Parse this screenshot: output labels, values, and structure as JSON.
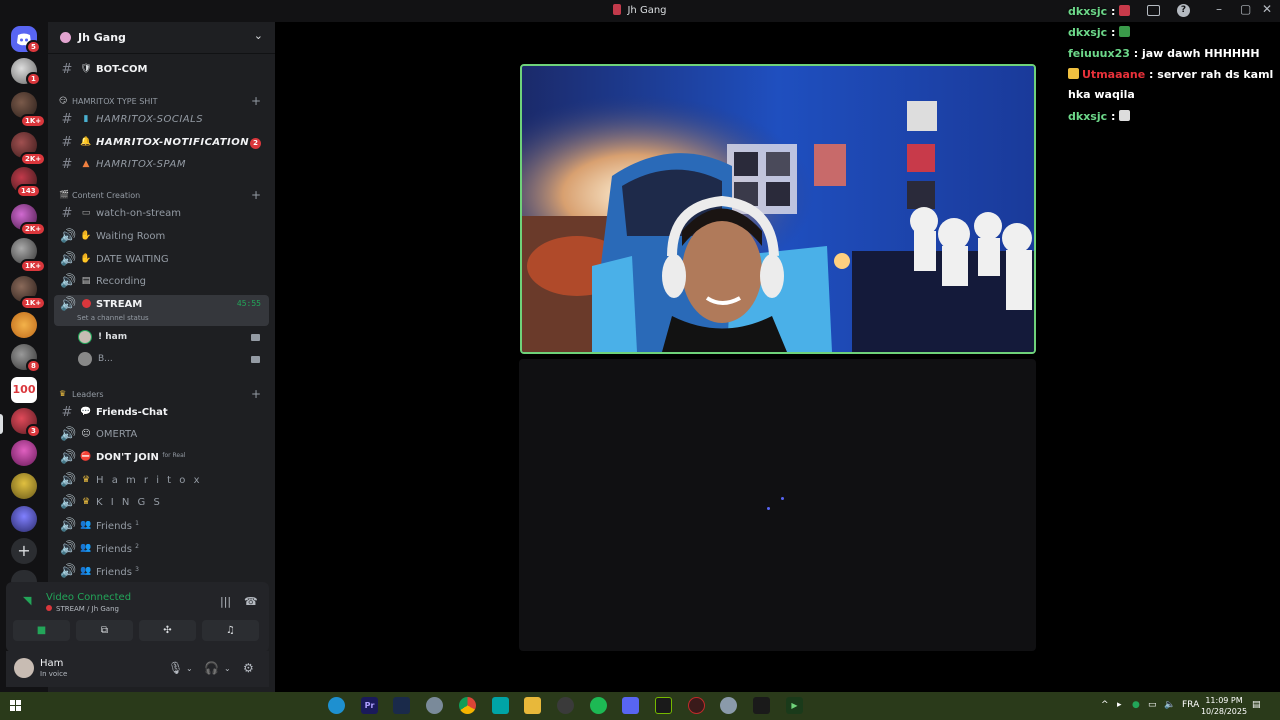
{
  "window": {
    "title": "Jh Gang"
  },
  "guild": {
    "name": "Jh Gang"
  },
  "rail_badges": [
    "5",
    "1",
    "1K+",
    "2K+",
    "143",
    "2K+",
    "1K+",
    "1K+",
    "8",
    "3"
  ],
  "channels": {
    "bot_com": {
      "emoji": "🛡",
      "name": "BOT-COM"
    },
    "cat_hamritox": {
      "emoji": "😏",
      "name": "HAMRITOX TYPE SHIT"
    },
    "socials": {
      "name": "HAMRITOX-SOCIALS"
    },
    "notification": {
      "name": "HAMRITOX-NOTIFICATION",
      "badge": "2"
    },
    "spam": {
      "name": "HAMRITOX-SPAM"
    },
    "cat_content": {
      "name": "Content Creation"
    },
    "watch_on_stream": {
      "name": "watch-on-stream"
    },
    "waiting_room": {
      "name": "Waiting Room"
    },
    "date_waiting": {
      "name": "DATE WAITING"
    },
    "recording": {
      "name": "Recording"
    },
    "stream": {
      "name": "STREAM",
      "timer": "45:55",
      "status": "Set a channel status"
    },
    "voice_users": [
      {
        "name": "! ham"
      },
      {
        "name": "B..."
      }
    ],
    "cat_leaders": {
      "name": "Leaders"
    },
    "friends_chat": {
      "name": "Friends-Chat"
    },
    "omerta": {
      "name": "OMERTA"
    },
    "dont_join": {
      "name": "DON'T JOIN",
      "suffix": "for Real"
    },
    "hamritox": {
      "name": "H a m r i t o x"
    },
    "kings": {
      "name": "K I N G S"
    },
    "friends1": {
      "name": "Friends",
      "sup": "1"
    },
    "friends2": {
      "name": "Friends",
      "sup": "2"
    },
    "friends3": {
      "name": "Friends",
      "sup": "3"
    }
  },
  "voice": {
    "title": "Video Connected",
    "subtitle": "STREAM / Jh Gang"
  },
  "user": {
    "name": "Ham",
    "status": "In voice"
  },
  "chat": [
    {
      "author": "dkxsjc",
      "sep": " : ",
      "text": ""
    },
    {
      "author": "dkxsjc",
      "sep": " : ",
      "text": ""
    },
    {
      "author": "feiuuux23",
      "sep": " : ",
      "text": "jaw dawh HHHHHH"
    },
    {
      "author": "Utmaaane",
      "sep": " : ",
      "text": "server rah ds kaml"
    },
    {
      "author": "",
      "sep": "",
      "text": "hka waqila"
    },
    {
      "author": "dkxsjc",
      "sep": " : ",
      "text": ""
    }
  ],
  "taskbar": {
    "premiere_label": "Pr",
    "language": "FRA",
    "time": "11:09 PM",
    "date": "10/28/2025"
  },
  "colors": {
    "accent": "#5865f2",
    "online": "#23a559",
    "danger": "#da373c",
    "video_border": "#6fd27a"
  }
}
